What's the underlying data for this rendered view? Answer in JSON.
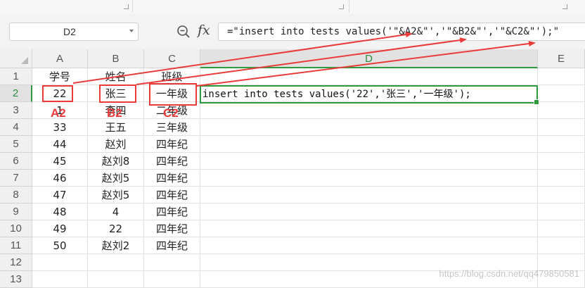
{
  "name_box": "D2",
  "formula_bar": {
    "fx_label": "fx",
    "formula": "=\"insert into tests values('\"&A2&\"','\"&B2&\"','\"&C2&\"');\""
  },
  "columns": [
    "A",
    "B",
    "C",
    "D",
    "E"
  ],
  "rows": [
    {
      "num": "1",
      "a": "学号",
      "b": "姓名",
      "c": "班级"
    },
    {
      "num": "2",
      "a": "22",
      "b": "张三",
      "c": "一年级",
      "d": "insert into tests values('22','张三','一年级');"
    },
    {
      "num": "3",
      "a": "1",
      "b": "李四",
      "c": "二年级"
    },
    {
      "num": "4",
      "a": "33",
      "b": "王五",
      "c": "三年级"
    },
    {
      "num": "5",
      "a": "44",
      "b": "赵刘",
      "c": "四年纪"
    },
    {
      "num": "6",
      "a": "45",
      "b": "赵刘8",
      "c": "四年纪"
    },
    {
      "num": "7",
      "a": "46",
      "b": "赵刘5",
      "c": "四年纪"
    },
    {
      "num": "8",
      "a": "47",
      "b": "赵刘5",
      "c": "四年纪"
    },
    {
      "num": "9",
      "a": "48",
      "b": "4",
      "c": "四年纪"
    },
    {
      "num": "10",
      "a": "49",
      "b": "22",
      "c": "四年纪"
    },
    {
      "num": "11",
      "a": "50",
      "b": "赵刘2",
      "c": "四年纪"
    },
    {
      "num": "12"
    },
    {
      "num": "13"
    }
  ],
  "annotations": {
    "a2": "A2",
    "b2": "B2",
    "c2": "C2"
  },
  "watermark": "https://blog.csdn.net/qq479850581",
  "colors": {
    "selection": "#2e9a3e",
    "annotation": "#ea3b3b"
  }
}
